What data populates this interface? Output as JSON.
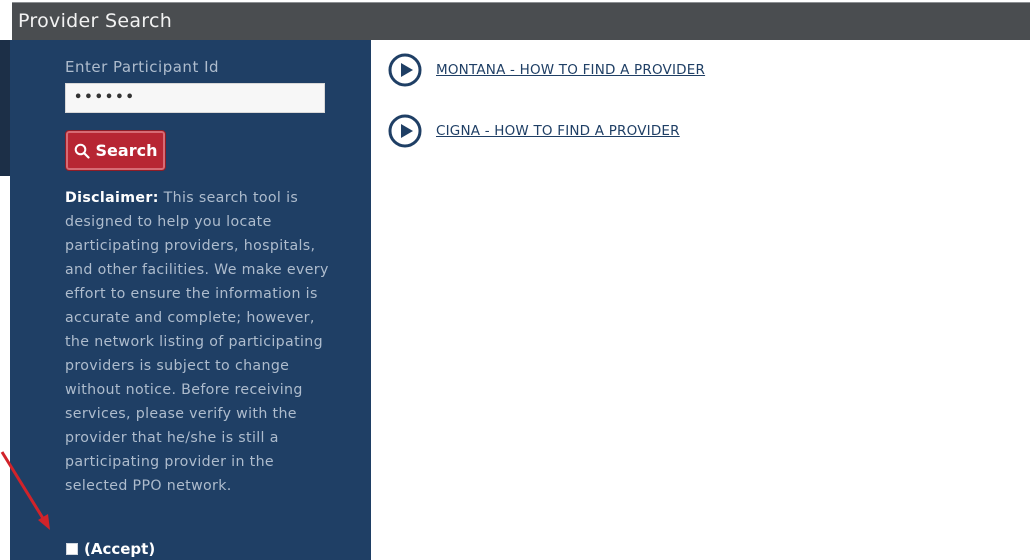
{
  "header": {
    "title": "Provider Search"
  },
  "sidebar": {
    "participant_label": "Enter Participant Id",
    "participant_value": "••••••",
    "search_label": "Search",
    "search_icon": "search-icon",
    "disclaimer_heading": "Disclaimer:",
    "disclaimer_text": "This search tool is designed to help you locate participating providers, hospitals, and other facilities. We make every effort to ensure the information is accurate and complete; however, the network listing of participating providers is subject to change without notice. Before receiving services, please verify with the provider that he/she is still a participating provider in the selected PPO network.",
    "accept_label": "(Accept)"
  },
  "videos": [
    {
      "label": "MONTANA - HOW TO FIND A PROVIDER",
      "icon": "play-circle-icon"
    },
    {
      "label": "CIGNA - HOW TO FIND A PROVIDER",
      "icon": "play-circle-icon"
    }
  ],
  "colors": {
    "header_bg": "#4a4d50",
    "sidebar_bg": "#1f3f65",
    "search_button": "#b72633",
    "link": "#1f3f65",
    "annotation_arrow": "#d1232a"
  }
}
